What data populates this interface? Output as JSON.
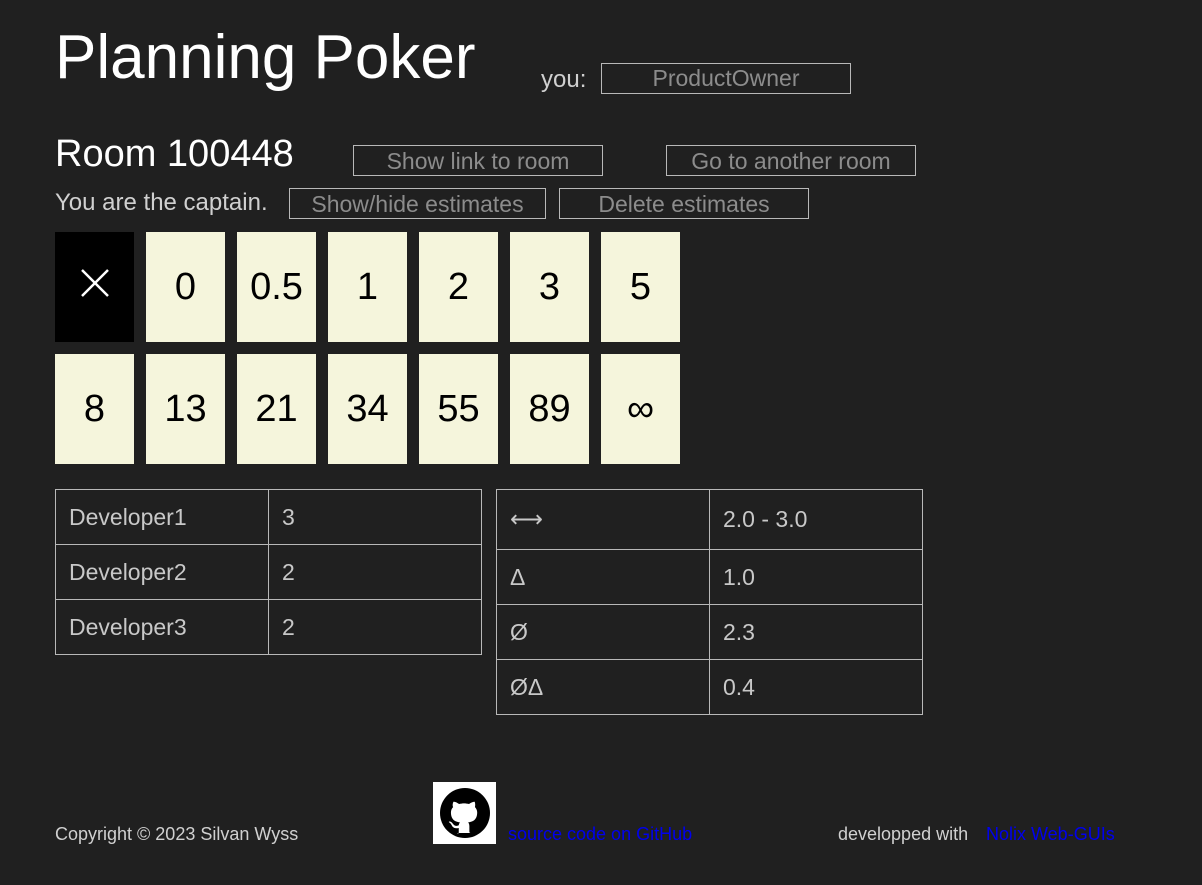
{
  "header": {
    "title": "Planning Poker",
    "you_label": "you:",
    "user_name": "ProductOwner"
  },
  "room": {
    "title": "Room 100448",
    "show_link_label": "Show link to room",
    "other_room_label": "Go to another room",
    "captain_text": "You are the captain.",
    "toggle_estimates_label": "Show/hide estimates",
    "delete_estimates_label": "Delete estimates"
  },
  "cards": [
    {
      "label": "",
      "icon": "close-icon",
      "selected": true
    },
    {
      "label": "0"
    },
    {
      "label": "0.5"
    },
    {
      "label": "1"
    },
    {
      "label": "2"
    },
    {
      "label": "3"
    },
    {
      "label": "5"
    },
    {
      "label": "8"
    },
    {
      "label": "13"
    },
    {
      "label": "21"
    },
    {
      "label": "34"
    },
    {
      "label": "55"
    },
    {
      "label": "89"
    },
    {
      "label": "∞"
    }
  ],
  "estimates": [
    {
      "name": "Developer1",
      "value": "3"
    },
    {
      "name": "Developer2",
      "value": "2"
    },
    {
      "name": "Developer3",
      "value": "2"
    }
  ],
  "statistics": [
    {
      "symbol": "⟷",
      "value": "2.0 - 3.0"
    },
    {
      "symbol": "Δ",
      "value": "1.0"
    },
    {
      "symbol": "Ø",
      "value": "2.3"
    },
    {
      "symbol": "ØΔ",
      "value": "0.4"
    }
  ],
  "footer": {
    "copyright": "Copyright © 2023 Silvan Wyss",
    "github_link": "source code on GitHub",
    "developed_with": "developped with",
    "nolix_link": "Nolix Web-GUIs"
  },
  "colors": {
    "background": "#202020",
    "card": "#f5f5dc",
    "card_selected": "#000000",
    "link": "#0000ee"
  }
}
